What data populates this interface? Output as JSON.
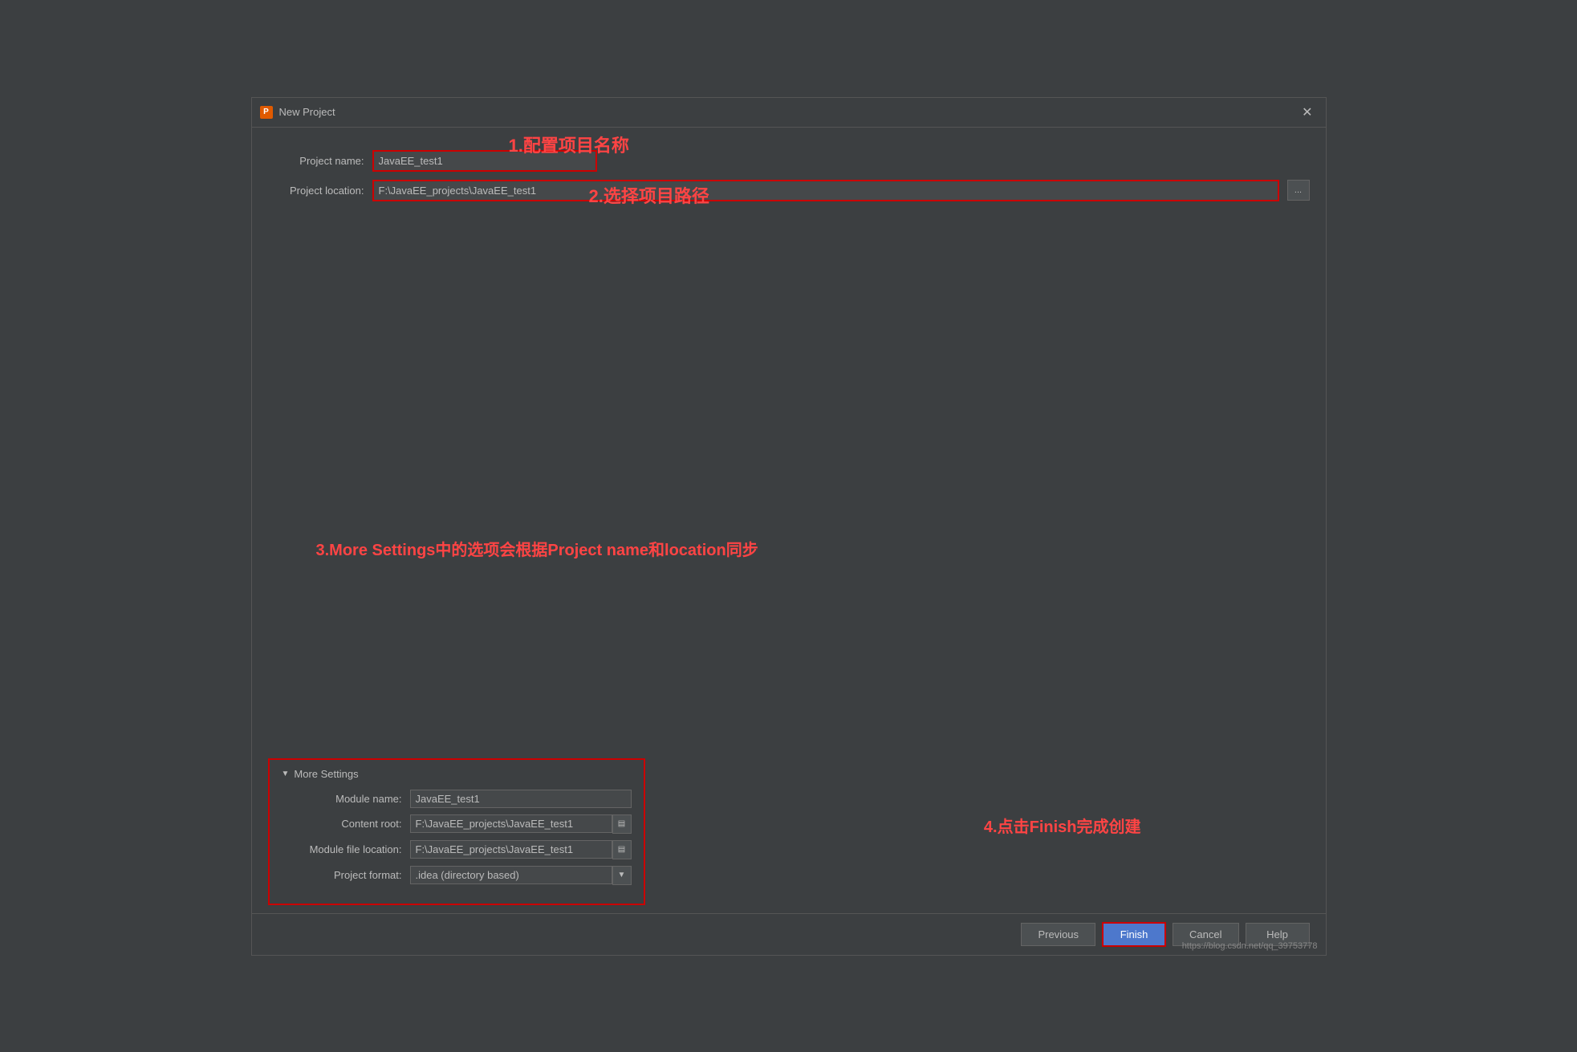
{
  "window": {
    "title": "New Project",
    "close_btn": "✕"
  },
  "annotations": {
    "step1": "1.配置项目名称",
    "step2": "2.选择项目路径",
    "step3": "3.More Settings中的选项会根据Project name和location同步",
    "step4": "4.点击Finish完成创建"
  },
  "form": {
    "project_name_label": "Project name:",
    "project_name_value": "JavaEE_test1",
    "project_location_label": "Project location:",
    "project_location_value": "F:\\JavaEE_projects\\JavaEE_test1",
    "browse_label": "..."
  },
  "more_settings": {
    "title": "More Settings",
    "module_name_label": "Module name:",
    "module_name_value": "JavaEE_test1",
    "content_root_label": "Content root:",
    "content_root_value": "F:\\JavaEE_projects\\JavaEE_test1",
    "module_file_label": "Module file location:",
    "module_file_value": "F:\\JavaEE_projects\\JavaEE_test1",
    "project_format_label": "Project format:",
    "project_format_value": ".idea (directory based)",
    "browse_icon": "▤"
  },
  "footer": {
    "previous_label": "Previous",
    "finish_label": "Finish",
    "cancel_label": "Cancel",
    "help_label": "Help"
  },
  "watermark": "https://blog.csdn.net/qq_39753778"
}
